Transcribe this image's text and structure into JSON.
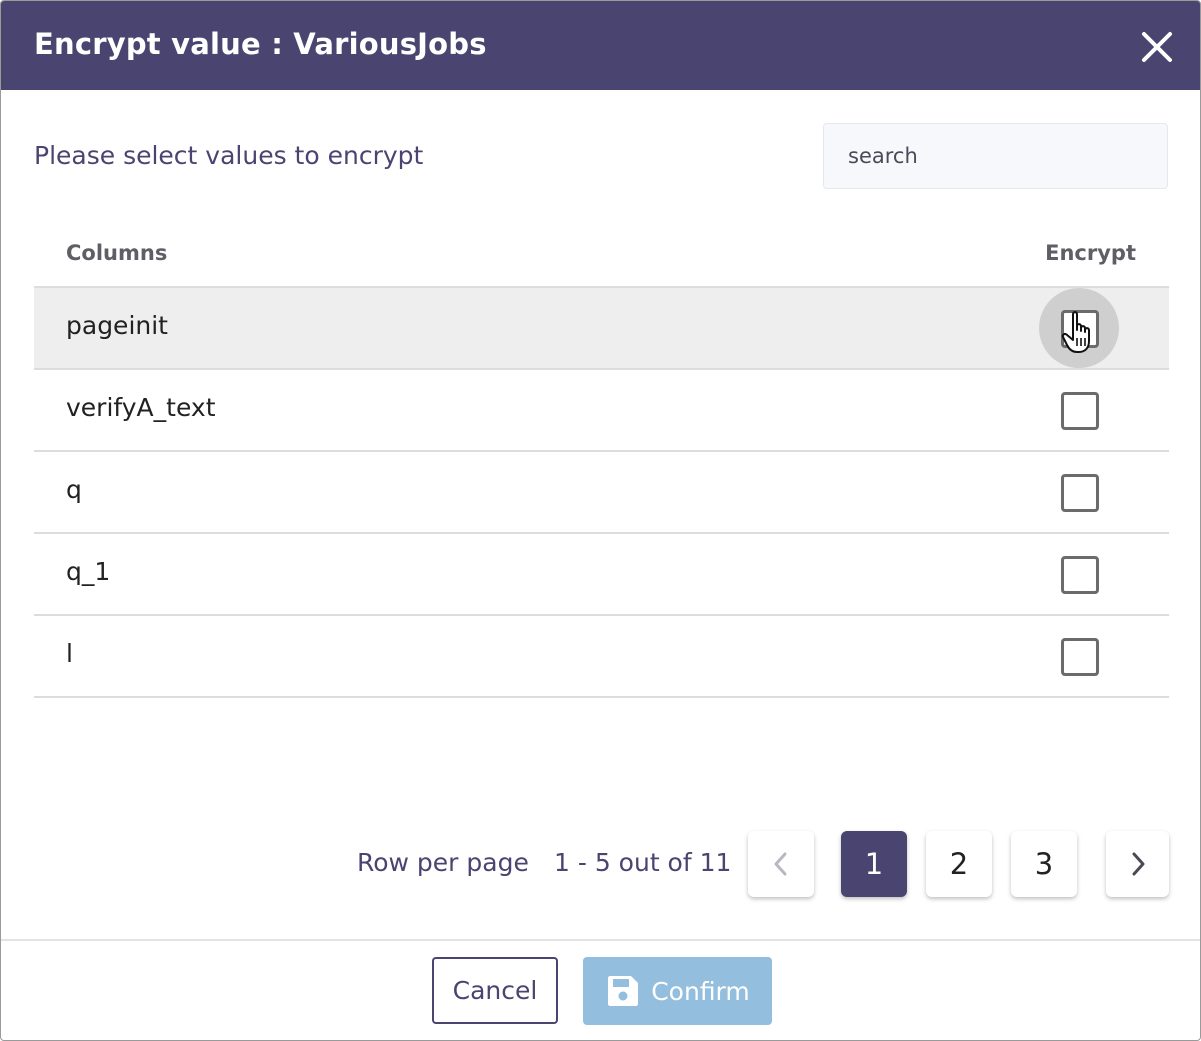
{
  "dialog": {
    "title": "Encrypt value : VariousJobs",
    "subtitle": "Please select values to encrypt",
    "search_placeholder": "search"
  },
  "table": {
    "headers": {
      "columns": "Columns",
      "encrypt": "Encrypt"
    },
    "rows": [
      {
        "label": "pageinit",
        "encrypt": false
      },
      {
        "label": "verifyA_text",
        "encrypt": false
      },
      {
        "label": "q",
        "encrypt": false
      },
      {
        "label": "q_1",
        "encrypt": false
      },
      {
        "label": "l",
        "encrypt": false
      }
    ]
  },
  "pagination": {
    "rows_per_page_label": "Row per page",
    "range_text": "1 - 5 out of 11",
    "pages": [
      "1",
      "2",
      "3"
    ],
    "current_page": "1"
  },
  "footer": {
    "cancel_label": "Cancel",
    "confirm_label": "Confirm"
  },
  "colors": {
    "header_bg": "#4a4570",
    "active_page_bg": "#4a4570",
    "confirm_disabled_bg": "#93bedd"
  },
  "icons": {
    "close": "close-icon",
    "prev": "chevron-left-icon",
    "next": "chevron-right-icon",
    "save": "save-icon",
    "cursor": "hand-pointer-icon"
  }
}
